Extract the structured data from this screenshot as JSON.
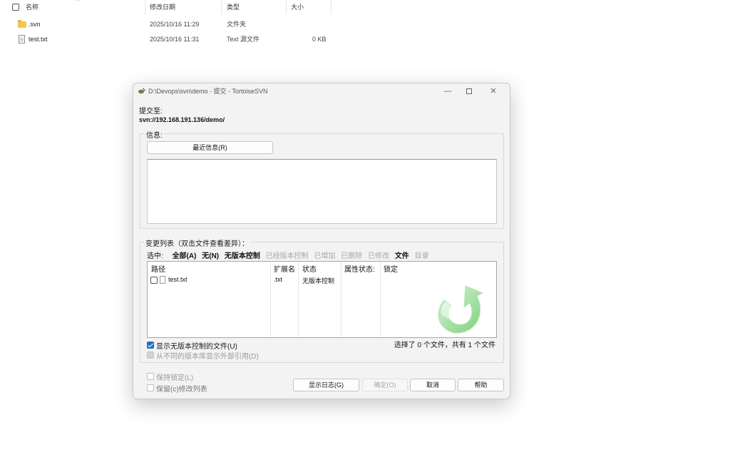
{
  "explorer": {
    "columns": {
      "name": "名称",
      "modified": "修改日期",
      "type": "类型",
      "size": "大小"
    },
    "rows": [
      {
        "name": ".svn",
        "modified": "2025/10/16 11:29",
        "type": "文件夹",
        "size": ""
      },
      {
        "name": "test.txt",
        "modified": "2025/10/16 11:31",
        "type": "Text 源文件",
        "size": "0 KB"
      }
    ]
  },
  "dialog": {
    "title": "D:\\Devops\\svn\\demo - 提交 - TortoiseSVN",
    "window_controls": {
      "minimize": "—",
      "close": "✕"
    },
    "commit_to_label": "提交至:",
    "commit_url": "svn://192.168.191.136/demo/",
    "message_group": {
      "title": "信息:",
      "recent_button": "最近信息(R)",
      "message_text": ""
    },
    "changes_group": {
      "title": "变更列表（双击文件查看差异）：",
      "select_label": "选中:",
      "filters": [
        {
          "label": "全部(A)",
          "state": "bold"
        },
        {
          "label": "无(N)",
          "state": "bold"
        },
        {
          "label": "无版本控制",
          "state": "bold"
        },
        {
          "label": "已经版本控制",
          "state": "dim"
        },
        {
          "label": "已增加",
          "state": "dim"
        },
        {
          "label": "已删除",
          "state": "dim"
        },
        {
          "label": "已修改",
          "state": "dim"
        },
        {
          "label": "文件",
          "state": "bold"
        },
        {
          "label": "目录",
          "state": "dim"
        }
      ],
      "table": {
        "columns": {
          "path": "路径",
          "ext": "扩展名",
          "status": "状态",
          "prop_status": "属性状态:",
          "lock": "锁定"
        },
        "rows": [
          {
            "path": "test.txt",
            "ext": ".txt",
            "status": "无版本控制",
            "prop_status": "",
            "lock": "",
            "checked": false
          }
        ]
      },
      "show_unversioned": {
        "label": "显示无版本控制的文件(U)",
        "checked": true
      },
      "show_externals": {
        "label": "从不同的版本库显示外部引用(D)",
        "checked": true,
        "disabled": true
      },
      "summary": "选择了 0 个文件，共有 1 个文件"
    },
    "keep_locks": {
      "label": "保持锁定(L)",
      "checked": false
    },
    "keep_changelists": {
      "label": "保留(c)修改列表",
      "checked": false
    },
    "buttons": {
      "show_log": "显示日志(G)",
      "ok": "确定(O)",
      "cancel": "取消",
      "help": "帮助"
    },
    "colors": {
      "accent": "#1f6fc5",
      "arrow_green": "#7cd07c"
    }
  }
}
